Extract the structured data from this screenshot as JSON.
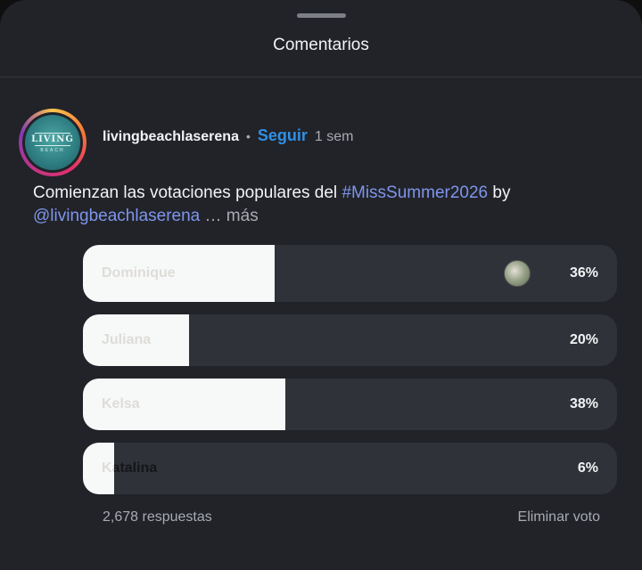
{
  "sheet": {
    "title": "Comentarios"
  },
  "post": {
    "avatar_logo": "LIVING",
    "avatar_logo_sub": "BEACH",
    "username": "livingbeachlaserena",
    "separator": "•",
    "follow_label": "Seguir",
    "time": "1 sem",
    "caption": {
      "text_1": "Comienzan las votaciones populares del ",
      "hashtag": "#MissSummer2026",
      "text_2": " by",
      "mention": "@livingbeachlaserena",
      "more": " … más"
    }
  },
  "poll": {
    "options": [
      {
        "label": "Dominique",
        "percent_text": "36%",
        "percent": 36,
        "has_voter_avatar": true
      },
      {
        "label": "Juliana",
        "percent_text": "20%",
        "percent": 20
      },
      {
        "label": "Kelsa",
        "percent_text": "38%",
        "percent": 38
      },
      {
        "label": "Katalina",
        "percent_text": "6%",
        "percent": 6
      }
    ],
    "responses": "2,678 respuestas",
    "remove_vote_label": "Eliminar voto"
  },
  "colors": {
    "sheet_bg": "#212328",
    "accent_follow": "#2f90e6",
    "link": "#7f95ec",
    "poll_fill": "#f7f8f8",
    "poll_track": "#2f3239"
  }
}
